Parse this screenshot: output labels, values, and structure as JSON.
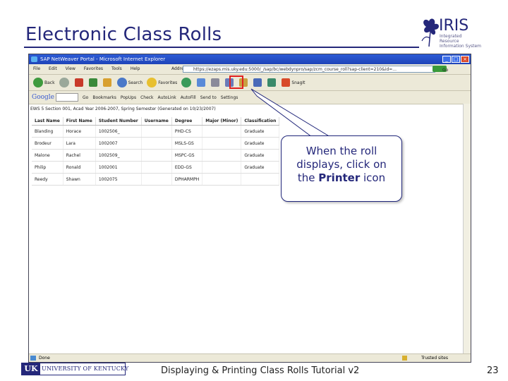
{
  "slide": {
    "title": "Electronic Class Rolls",
    "footer": "Displaying & Printing Class Rolls Tutorial v2",
    "page_number": "23"
  },
  "logo": {
    "name": "IRIS",
    "subtitle": "Integrated Resource Information System"
  },
  "uk_logo": {
    "mark": "UK",
    "name": "UNIVERSITY OF KENTUCKY"
  },
  "browser": {
    "window_title": "SAP NetWeaver Portal - Microsoft Internet Explorer",
    "menu": [
      "File",
      "Edit",
      "View",
      "Favorites",
      "Tools",
      "Help"
    ],
    "address_label": "Address",
    "address_value": "https://ezaps.mis.uky.edu:5000/_/sap/bc/webdynpro/sap/zcm_course_roll?sap-client=210&id=...",
    "go_label": "Go",
    "toolbar": {
      "back": "Back",
      "search": "Search",
      "favorites": "Favorites",
      "snagit": "SnagIt"
    },
    "google_bar": {
      "google": "Google",
      "go": "Go",
      "bookmarks": "Bookmarks",
      "popups": "PopUps",
      "check": "Check",
      "autolink": "AutoLink",
      "autofill": "AutoFill",
      "send_to": "Send to",
      "settings": "Settings"
    },
    "status": "Done",
    "zone": "Trusted sites"
  },
  "roll": {
    "section_line": "EWS 5 Section 001, Acad Year 2006-2007, Spring Semester (Generated on 10/23/2007)",
    "columns": [
      "Last Name",
      "First Name",
      "Student Number",
      "Username",
      "Degree",
      "Major (Minor)",
      "Classification"
    ],
    "rows": [
      [
        "Blanding",
        "Horace",
        "1002506_",
        "",
        "PHD-CS",
        "",
        "Graduate"
      ],
      [
        "Brodeur",
        "Lara",
        "1002007",
        "",
        "MSLS-GS",
        "",
        "Graduate"
      ],
      [
        "Malone",
        "Rachel",
        "1002509_",
        "",
        "MSPC-GS",
        "",
        "Graduate"
      ],
      [
        "Philip",
        "Ronald",
        "1002001",
        "",
        "EDD-GS",
        "",
        "Graduate"
      ],
      [
        "Reedy",
        "Shawn",
        "1002075",
        "",
        "DPHARMPH",
        "",
        ""
      ]
    ]
  },
  "callout": {
    "line1": "When the roll",
    "line2": "displays, click on",
    "prefix3": "the ",
    "bold": "Printer",
    "suffix3": " icon"
  }
}
